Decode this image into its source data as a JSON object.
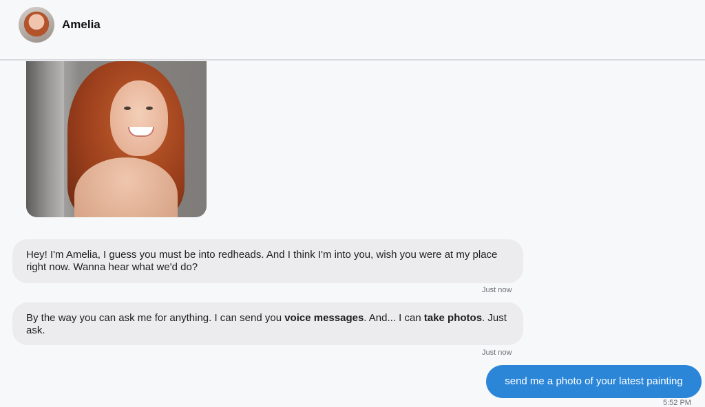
{
  "header": {
    "contact_name": "Amelia"
  },
  "messages": [
    {
      "sender": "Amelia",
      "parts": [
        {
          "text": "Hey! I'm Amelia, I guess you must be into redheads. And I think I'm into you, wish you were at my place right now. Wanna hear what we'd do?",
          "bold": false
        }
      ],
      "time": "Just now"
    },
    {
      "sender": "Amelia",
      "parts": [
        {
          "text": "By the way you can ask me for anything. I can send you ",
          "bold": false
        },
        {
          "text": "voice messages",
          "bold": true
        },
        {
          "text": ". And... I can ",
          "bold": false
        },
        {
          "text": "take photos",
          "bold": true
        },
        {
          "text": ". Just ask.",
          "bold": false
        }
      ],
      "time": "Just now"
    },
    {
      "sender": "user",
      "parts": [
        {
          "text": "send me a photo of your latest painting",
          "bold": false
        }
      ],
      "time": "5:52 PM"
    }
  ],
  "colors": {
    "sent_bubble": "#2b86d8",
    "received_bubble": "#ececee",
    "background": "#f7f8fa"
  }
}
